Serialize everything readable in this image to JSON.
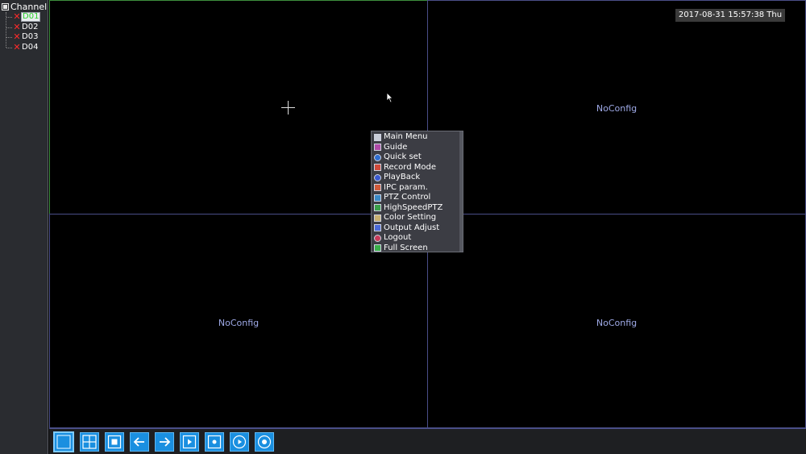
{
  "sidebar": {
    "root_label": "Channel",
    "channels": [
      {
        "label": "D01",
        "status": "disconnected",
        "selected": true
      },
      {
        "label": "D02",
        "status": "disconnected",
        "selected": false
      },
      {
        "label": "D03",
        "status": "disconnected",
        "selected": false
      },
      {
        "label": "D04",
        "status": "disconnected",
        "selected": false
      }
    ],
    "x_mark": "✕"
  },
  "datetime": "2017-08-31 15:57:38 Thu",
  "cells": [
    {
      "id": 1,
      "label": ""
    },
    {
      "id": 2,
      "label": "NoConfig"
    },
    {
      "id": 3,
      "label": "NoConfig"
    },
    {
      "id": 4,
      "label": "NoConfig"
    }
  ],
  "context_menu": {
    "items": [
      {
        "label": "Main Menu",
        "icon": "home-icon",
        "color": "#c8ccd8"
      },
      {
        "label": "Guide",
        "icon": "guide-icon",
        "color": "#b04aa8"
      },
      {
        "label": "Quick set",
        "icon": "quick-set-icon",
        "color": "#2f6fd0"
      },
      {
        "label": "Record Mode",
        "icon": "record-icon",
        "color": "#d04a3a"
      },
      {
        "label": "PlayBack",
        "icon": "playback-icon",
        "color": "#3a5ad0"
      },
      {
        "label": "IPC param.",
        "icon": "ipc-icon",
        "color": "#d05a3a"
      },
      {
        "label": "PTZ Control",
        "icon": "ptz-icon",
        "color": "#3a8ac8"
      },
      {
        "label": "HighSpeedPTZ",
        "icon": "highspeed-ptz-icon",
        "color": "#3aa04a"
      },
      {
        "label": "Color Setting",
        "icon": "color-grid-icon",
        "color": "#c8b070"
      },
      {
        "label": "Output Adjust",
        "icon": "output-adjust-icon",
        "color": "#4a6ad8"
      },
      {
        "label": "Logout",
        "icon": "power-icon",
        "color": "#c83a5a"
      },
      {
        "label": "Full Screen",
        "icon": "fullscreen-icon",
        "color": "#3ab04a"
      }
    ]
  },
  "toolbar": {
    "buttons": [
      {
        "name": "single-view",
        "icon": "single-view-icon",
        "active": true
      },
      {
        "name": "quad-view",
        "icon": "quad-view-icon",
        "active": false
      },
      {
        "name": "stop-view",
        "icon": "stop-icon",
        "active": false
      },
      {
        "name": "previous",
        "icon": "arrow-left-icon",
        "active": false
      },
      {
        "name": "next",
        "icon": "arrow-right-icon",
        "active": false
      },
      {
        "name": "play",
        "icon": "play-icon",
        "active": false
      },
      {
        "name": "record",
        "icon": "record-square-icon",
        "active": false
      },
      {
        "name": "playback",
        "icon": "play-circle-icon",
        "active": false
      },
      {
        "name": "snapshot",
        "icon": "target-icon",
        "active": false
      }
    ],
    "accent_color": "#1a8fe0"
  }
}
